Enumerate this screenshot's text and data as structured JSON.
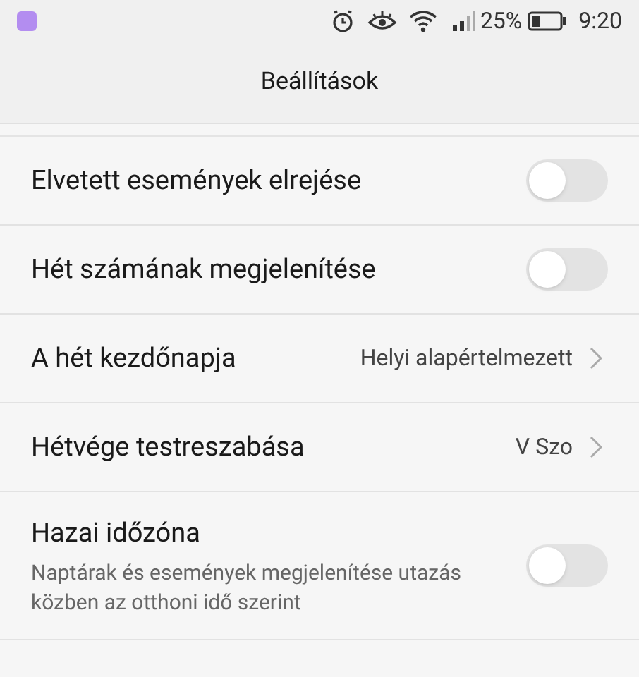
{
  "status_bar": {
    "battery_text": "25%",
    "time": "9:20"
  },
  "title": "Beállítások",
  "settings": [
    {
      "kind": "toggle",
      "label": "Elvetett események elrejése",
      "on": false
    },
    {
      "kind": "toggle",
      "label": "Hét számának megjelenítése",
      "on": false
    },
    {
      "kind": "link",
      "label": "A hét kezdőnapja",
      "value": "Helyi alapértelmezett"
    },
    {
      "kind": "link",
      "label": "Hétvége testreszabása",
      "value": "V Szo"
    },
    {
      "kind": "toggle",
      "label": "Hazai időzóna",
      "description": "Naptárak és események megjelenítése utazás közben az otthoni idő szerint",
      "on": false
    }
  ]
}
